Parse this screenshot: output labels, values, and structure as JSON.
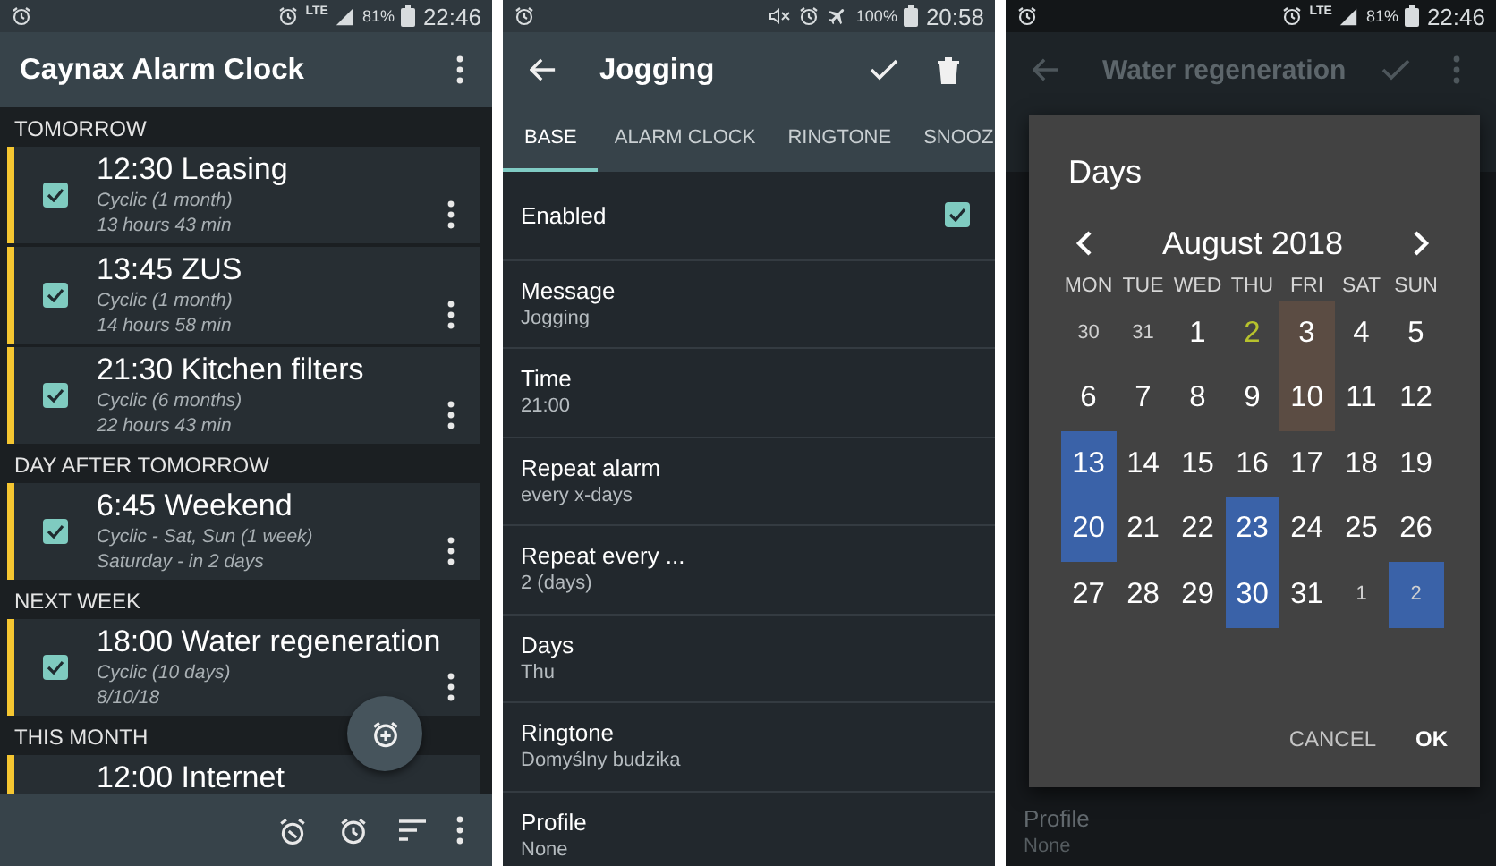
{
  "alarm_list": {
    "status_bar": {
      "network": "LTE",
      "battery": "81%",
      "time": "22:46"
    },
    "title": "Caynax Alarm Clock",
    "sections": [
      {
        "title": "TOMORROW",
        "alarms": [
          {
            "title": "12:30 Leasing",
            "details": [
              "Cyclic (1 month)",
              "13 hours 43 min"
            ],
            "enabled": true
          },
          {
            "title": "13:45 ZUS",
            "details": [
              "Cyclic (1 month)",
              "14 hours 58 min"
            ],
            "enabled": true
          },
          {
            "title": "21:30 Kitchen filters",
            "details": [
              "Cyclic (6 months)",
              "22 hours 43 min"
            ],
            "enabled": true
          }
        ]
      },
      {
        "title": "DAY AFTER TOMORROW",
        "alarms": [
          {
            "title": "6:45 Weekend",
            "details": [
              "Cyclic - Sat, Sun (1 week)",
              "Saturday - in 2 days"
            ],
            "enabled": true
          }
        ]
      },
      {
        "title": "NEXT WEEK",
        "alarms": [
          {
            "title": "18:00 Water regeneration",
            "details": [
              "Cyclic (10 days)",
              "8/10/18"
            ],
            "enabled": true
          }
        ]
      },
      {
        "title": "THIS MONTH",
        "alarms": [
          {
            "title": "12:00 Internet"
          }
        ]
      }
    ]
  },
  "alarm_editor": {
    "status_bar": {
      "battery": "100%",
      "time": "20:58",
      "airplane_mode": true,
      "muted": true
    },
    "title": "Jogging",
    "tabs": [
      {
        "label": "BASE",
        "selected": true
      },
      {
        "label": "ALARM CLOCK",
        "selected": false
      },
      {
        "label": "RINGTONE",
        "selected": false
      },
      {
        "label": "SNOOZ",
        "selected": false
      }
    ],
    "settings": [
      {
        "kind": "checkbox",
        "label": "Enabled",
        "checked": true
      },
      {
        "kind": "value",
        "label": "Message",
        "value": "Jogging"
      },
      {
        "kind": "value",
        "label": "Time",
        "value": "21:00"
      },
      {
        "kind": "value",
        "label": "Repeat alarm",
        "value": "every x-days"
      },
      {
        "kind": "value",
        "label": "Repeat every ...",
        "value": "2 (days)"
      },
      {
        "kind": "value",
        "label": "Days",
        "value": "Thu"
      },
      {
        "kind": "value",
        "label": "Ringtone",
        "value": "Domyślny budzika"
      },
      {
        "kind": "value",
        "label": "Profile",
        "value": "None"
      }
    ]
  },
  "days_screen": {
    "status_bar": {
      "network": "LTE",
      "battery": "81%",
      "time": "22:46"
    },
    "title": "Water regeneration",
    "settings": [
      {
        "label": "Profile",
        "value": "None"
      }
    ],
    "dialog": {
      "title": "Days",
      "month": "August 2018",
      "weekdays": [
        "MON",
        "TUE",
        "WED",
        "THU",
        "FRI",
        "SAT",
        "SUN"
      ],
      "days": [
        {
          "label": "30",
          "outside": true,
          "today": false,
          "marked": false,
          "selected": false
        },
        {
          "label": "31",
          "outside": true,
          "today": false,
          "marked": false,
          "selected": false
        },
        {
          "label": "1",
          "outside": false,
          "today": false,
          "marked": false,
          "selected": false
        },
        {
          "label": "2",
          "outside": false,
          "today": true,
          "marked": false,
          "selected": false
        },
        {
          "label": "3",
          "outside": false,
          "today": false,
          "marked": true,
          "selected": false
        },
        {
          "label": "4",
          "outside": false,
          "today": false,
          "marked": false,
          "selected": false
        },
        {
          "label": "5",
          "outside": false,
          "today": false,
          "marked": false,
          "selected": false
        },
        {
          "label": "6",
          "outside": false,
          "today": false,
          "marked": false,
          "selected": false
        },
        {
          "label": "7",
          "outside": false,
          "today": false,
          "marked": false,
          "selected": false
        },
        {
          "label": "8",
          "outside": false,
          "today": false,
          "marked": false,
          "selected": false
        },
        {
          "label": "9",
          "outside": false,
          "today": false,
          "marked": false,
          "selected": false
        },
        {
          "label": "10",
          "outside": false,
          "today": false,
          "marked": true,
          "selected": false
        },
        {
          "label": "11",
          "outside": false,
          "today": false,
          "marked": false,
          "selected": false
        },
        {
          "label": "12",
          "outside": false,
          "today": false,
          "marked": false,
          "selected": false
        },
        {
          "label": "13",
          "outside": false,
          "today": false,
          "marked": false,
          "selected": true
        },
        {
          "label": "14",
          "outside": false,
          "today": false,
          "marked": false,
          "selected": false
        },
        {
          "label": "15",
          "outside": false,
          "today": false,
          "marked": false,
          "selected": false
        },
        {
          "label": "16",
          "outside": false,
          "today": false,
          "marked": false,
          "selected": false
        },
        {
          "label": "17",
          "outside": false,
          "today": false,
          "marked": false,
          "selected": false
        },
        {
          "label": "18",
          "outside": false,
          "today": false,
          "marked": false,
          "selected": false
        },
        {
          "label": "19",
          "outside": false,
          "today": false,
          "marked": false,
          "selected": false
        },
        {
          "label": "20",
          "outside": false,
          "today": false,
          "marked": false,
          "selected": true
        },
        {
          "label": "21",
          "outside": false,
          "today": false,
          "marked": false,
          "selected": false
        },
        {
          "label": "22",
          "outside": false,
          "today": false,
          "marked": false,
          "selected": false
        },
        {
          "label": "23",
          "outside": false,
          "today": false,
          "marked": false,
          "selected": true
        },
        {
          "label": "24",
          "outside": false,
          "today": false,
          "marked": false,
          "selected": false
        },
        {
          "label": "25",
          "outside": false,
          "today": false,
          "marked": false,
          "selected": false
        },
        {
          "label": "26",
          "outside": false,
          "today": false,
          "marked": false,
          "selected": false
        },
        {
          "label": "27",
          "outside": false,
          "today": false,
          "marked": false,
          "selected": false
        },
        {
          "label": "28",
          "outside": false,
          "today": false,
          "marked": false,
          "selected": false
        },
        {
          "label": "29",
          "outside": false,
          "today": false,
          "marked": false,
          "selected": false
        },
        {
          "label": "30",
          "outside": false,
          "today": false,
          "marked": false,
          "selected": true
        },
        {
          "label": "31",
          "outside": false,
          "today": false,
          "marked": false,
          "selected": false
        },
        {
          "label": "1",
          "outside": true,
          "today": false,
          "marked": false,
          "selected": false
        },
        {
          "label": "2",
          "outside": true,
          "today": false,
          "marked": false,
          "selected": true
        }
      ],
      "buttons": [
        {
          "label": "CANCEL",
          "kind": "secondary"
        },
        {
          "label": "OK",
          "kind": "primary"
        }
      ]
    }
  }
}
